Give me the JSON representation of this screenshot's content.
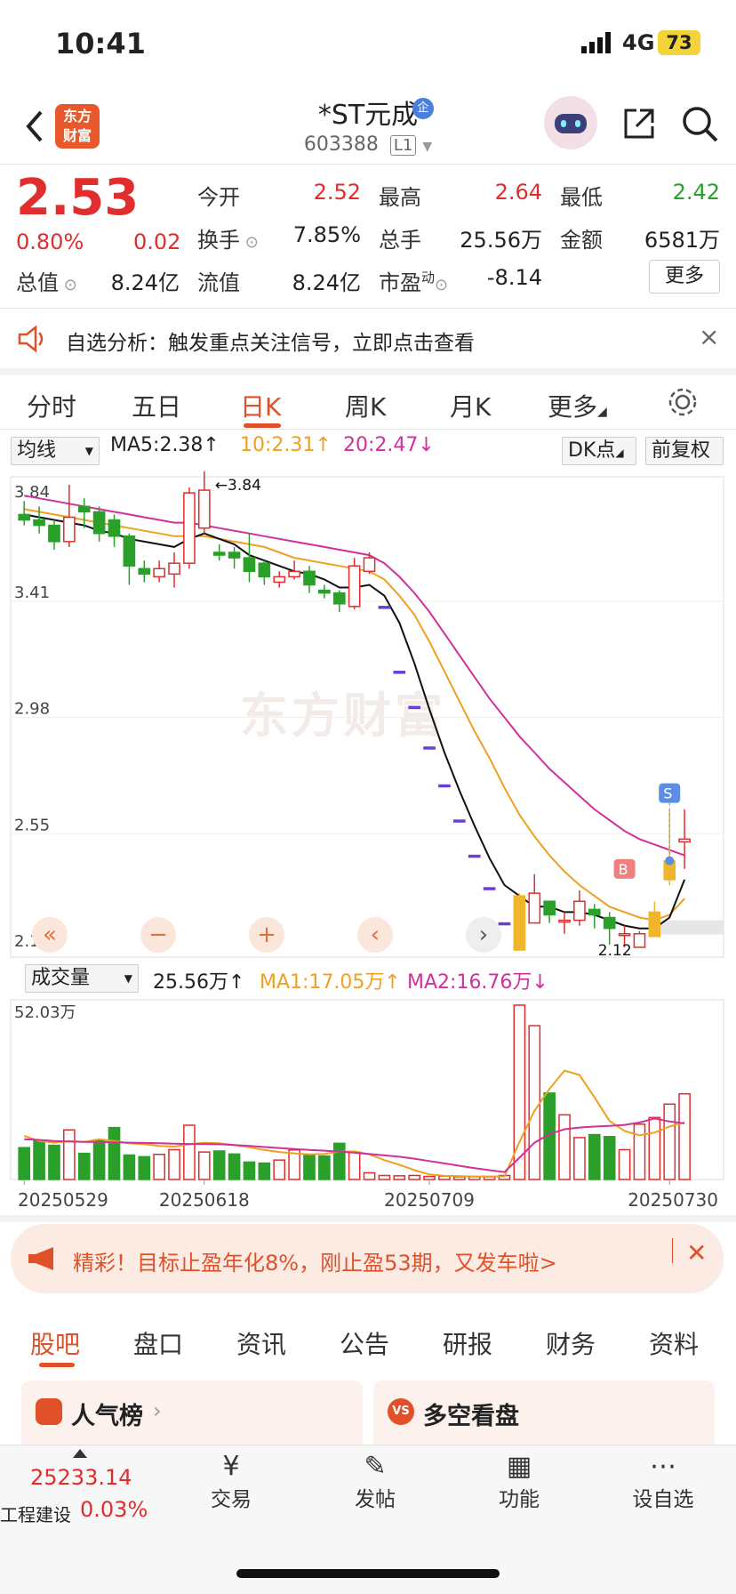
{
  "status_bar": {
    "time": "10:41",
    "network": "4G",
    "battery": "73"
  },
  "header": {
    "title": "*ST元成",
    "code": "603388",
    "level": "L1"
  },
  "quote": {
    "price": "2.53",
    "change_pct": "0.80%",
    "change": "0.02",
    "open_label": "今开",
    "open": "2.52",
    "high_label": "最高",
    "high": "2.64",
    "low_label": "最低",
    "low": "2.42",
    "turnover_label": "换手",
    "turnover": "7.85%",
    "volume_label": "总手",
    "volume": "25.56万",
    "amount_label": "金额",
    "amount": "6581万",
    "mktcap_label": "总值",
    "mktcap": "8.24亿",
    "float_label": "流值",
    "float": "8.24亿",
    "pe_label": "市盈",
    "pe_sup": "动",
    "pe": "-8.14",
    "more": "更多"
  },
  "notice": {
    "text": "自选分析：触发重点关注信号，立即点击查看"
  },
  "tabs": [
    {
      "label": "分时"
    },
    {
      "label": "五日"
    },
    {
      "label": "日K",
      "active": true
    },
    {
      "label": "周K"
    },
    {
      "label": "月K"
    },
    {
      "label": "更多"
    }
  ],
  "ma": {
    "selector": "均线",
    "ma5": "MA5:2.38↑",
    "ma10": "10:2.31↑",
    "ma20": "20:2.47↓",
    "dk": "DK点",
    "adjust": "前复权"
  },
  "vol_ma": {
    "selector": "成交量",
    "vol": "25.56万↑",
    "ma1": "MA1:17.05万↑",
    "ma2": "MA2:16.76万↓",
    "max_label": "52.03万"
  },
  "promo": {
    "text": "精彩！目标止盈年化8%，刚止盈53期，又发车啦>"
  },
  "bottom_tabs": [
    {
      "label": "股吧"
    },
    {
      "label": "盘口"
    },
    {
      "label": "资讯"
    },
    {
      "label": "公告"
    },
    {
      "label": "研报"
    },
    {
      "label": "财务"
    },
    {
      "label": "资料"
    }
  ],
  "cards": {
    "left": "人气榜",
    "right": "多空看盘"
  },
  "bottom_nav": {
    "index_value": "25233.14",
    "index_name": "工程建设",
    "index_change": "0.03%",
    "items": [
      {
        "label": "交易"
      },
      {
        "label": "发帖"
      },
      {
        "label": "功能"
      },
      {
        "label": "设自选"
      }
    ]
  },
  "watermark": "东方财富",
  "chart_data": {
    "type": "candlestick",
    "y_ticks": [
      "3.84",
      "3.41",
      "2.98",
      "2.55",
      "2.12"
    ],
    "ylim": [
      2.12,
      3.84
    ],
    "x_ticks": [
      "20250529",
      "20250618",
      "20250709",
      "20250730"
    ],
    "markers": {
      "high_label": "3.84",
      "low_label": "2.12",
      "buy": "B",
      "sell": "S"
    },
    "candles": [
      [
        3.73,
        3.71,
        3.78,
        3.69
      ],
      [
        3.71,
        3.69,
        3.76,
        3.66
      ],
      [
        3.69,
        3.63,
        3.71,
        3.6
      ],
      [
        3.63,
        3.72,
        3.84,
        3.61
      ],
      [
        3.76,
        3.74,
        3.79,
        3.68
      ],
      [
        3.74,
        3.66,
        3.76,
        3.63
      ],
      [
        3.71,
        3.65,
        3.73,
        3.61
      ],
      [
        3.65,
        3.54,
        3.66,
        3.47
      ],
      [
        3.53,
        3.51,
        3.56,
        3.48
      ],
      [
        3.5,
        3.53,
        3.56,
        3.48
      ],
      [
        3.51,
        3.55,
        3.59,
        3.46
      ],
      [
        3.55,
        3.81,
        3.83,
        3.53
      ],
      [
        3.68,
        3.82,
        3.89,
        3.66
      ],
      [
        3.59,
        3.58,
        3.62,
        3.56
      ],
      [
        3.59,
        3.57,
        3.61,
        3.53
      ],
      [
        3.57,
        3.52,
        3.66,
        3.48
      ],
      [
        3.55,
        3.5,
        3.56,
        3.47
      ],
      [
        3.48,
        3.5,
        3.52,
        3.46
      ],
      [
        3.5,
        3.52,
        3.56,
        3.49
      ],
      [
        3.52,
        3.47,
        3.54,
        3.44
      ],
      [
        3.45,
        3.44,
        3.47,
        3.42
      ],
      [
        3.44,
        3.4,
        3.45,
        3.37
      ],
      [
        3.39,
        3.54,
        3.57,
        3.38
      ],
      [
        3.52,
        3.57,
        3.59,
        3.51
      ],
      [
        3.39,
        3.39,
        3.39,
        3.39
      ],
      [
        3.15,
        3.15,
        3.15,
        3.15
      ],
      [
        3.02,
        3.02,
        3.02,
        3.02
      ],
      [
        2.87,
        2.87,
        2.87,
        2.87
      ],
      [
        2.73,
        2.73,
        2.73,
        2.73
      ],
      [
        2.6,
        2.6,
        2.6,
        2.6
      ],
      [
        2.47,
        2.47,
        2.47,
        2.47
      ],
      [
        2.35,
        2.35,
        2.35,
        2.35
      ],
      [
        2.22,
        2.22,
        2.22,
        2.22
      ],
      [
        2.12,
        2.32,
        2.33,
        2.12
      ],
      [
        2.22,
        2.33,
        2.4,
        2.22
      ],
      [
        2.3,
        2.25,
        2.3,
        2.22
      ],
      [
        2.23,
        2.23,
        2.26,
        2.18
      ],
      [
        2.23,
        2.3,
        2.34,
        2.21
      ],
      [
        2.27,
        2.25,
        2.29,
        2.2
      ],
      [
        2.24,
        2.2,
        2.26,
        2.14
      ],
      [
        2.18,
        2.18,
        2.21,
        2.13
      ],
      [
        2.13,
        2.18,
        2.19,
        2.13
      ],
      [
        2.17,
        2.26,
        2.3,
        2.17
      ],
      [
        2.38,
        2.45,
        2.64,
        2.36
      ],
      [
        2.52,
        2.53,
        2.64,
        2.42
      ]
    ],
    "ma5": [
      3.73,
      3.72,
      3.71,
      3.7,
      3.69,
      3.67,
      3.66,
      3.64,
      3.63,
      3.62,
      3.61,
      3.64,
      3.66,
      3.64,
      3.62,
      3.58,
      3.56,
      3.54,
      3.52,
      3.51,
      3.49,
      3.46,
      3.46,
      3.47,
      3.43,
      3.33,
      3.18,
      3.01,
      2.85,
      2.71,
      2.58,
      2.46,
      2.36,
      2.32,
      2.28,
      2.28,
      2.26,
      2.26,
      2.25,
      2.23,
      2.21,
      2.2,
      2.2,
      2.24,
      2.38
    ],
    "ma10": [
      3.75,
      3.74,
      3.73,
      3.72,
      3.71,
      3.7,
      3.69,
      3.68,
      3.67,
      3.66,
      3.65,
      3.65,
      3.65,
      3.64,
      3.63,
      3.62,
      3.61,
      3.59,
      3.57,
      3.56,
      3.55,
      3.54,
      3.53,
      3.52,
      3.49,
      3.43,
      3.36,
      3.26,
      3.15,
      3.04,
      2.93,
      2.83,
      2.72,
      2.62,
      2.54,
      2.47,
      2.41,
      2.36,
      2.32,
      2.28,
      2.26,
      2.24,
      2.23,
      2.25,
      2.31
    ],
    "ma20": [
      3.8,
      3.79,
      3.78,
      3.77,
      3.76,
      3.75,
      3.74,
      3.73,
      3.72,
      3.71,
      3.7,
      3.7,
      3.69,
      3.68,
      3.67,
      3.66,
      3.65,
      3.64,
      3.63,
      3.62,
      3.61,
      3.6,
      3.59,
      3.58,
      3.55,
      3.5,
      3.44,
      3.37,
      3.29,
      3.21,
      3.13,
      3.05,
      2.98,
      2.91,
      2.85,
      2.79,
      2.74,
      2.69,
      2.64,
      2.6,
      2.56,
      2.53,
      2.51,
      2.49,
      2.47
    ],
    "volume_max": 52.03,
    "volumes": [
      9.5,
      11.5,
      10.2,
      14.8,
      7.8,
      11.8,
      15.5,
      7.3,
      6.8,
      7.5,
      8.9,
      16.2,
      8.2,
      8.5,
      7.6,
      5.2,
      4.9,
      5.8,
      8.8,
      7.2,
      7.0,
      10.8,
      8.2,
      2.0,
      1.2,
      1.1,
      1.2,
      0.9,
      1.0,
      0.8,
      0.8,
      0.8,
      1.2,
      52.03,
      45.9,
      25.8,
      19.3,
      12.5,
      13.4,
      12.8,
      8.9,
      16.5,
      18.5,
      22.5,
      25.56
    ],
    "vol_ma1": [
      13,
      11.5,
      11,
      11.5,
      11.2,
      12,
      11.5,
      10.8,
      10.5,
      10,
      9.8,
      10.5,
      11,
      10.8,
      10.3,
      9.6,
      8.8,
      8.2,
      7.8,
      7.5,
      7.6,
      8.3,
      8.4,
      7.5,
      5.8,
      4.4,
      2.8,
      1.5,
      1.1,
      1.0,
      0.9,
      0.9,
      0.9,
      11.2,
      20.5,
      27,
      32.5,
      31.2,
      24.5,
      17.5,
      14.5,
      13.2,
      14,
      15.8,
      17.05
    ],
    "vol_ma2": [
      12,
      11.8,
      11.5,
      11.3,
      11.2,
      11.2,
      11.1,
      11,
      10.9,
      10.8,
      10.7,
      10.6,
      10.6,
      10.5,
      10.3,
      10,
      9.7,
      9.4,
      9.1,
      8.8,
      8.6,
      8.3,
      8,
      7.6,
      7.2,
      6.8,
      6.2,
      5.5,
      4.8,
      4.1,
      3.4,
      2.8,
      2.2,
      6.5,
      11,
      13.5,
      15,
      15.5,
      15.8,
      16,
      16.3,
      17,
      18.2,
      17.3,
      16.76
    ]
  }
}
